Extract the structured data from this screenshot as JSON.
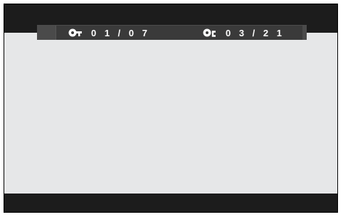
{
  "osd": {
    "title_icon": "title-key-icon",
    "title_value": "0 1 / 0 7",
    "chapter_icon": "chapter-key-icon",
    "chapter_value": "0 3 / 2 1"
  },
  "colors": {
    "frame": "#1c1c1c",
    "content": "#e6e7e8",
    "osd_bar": "#3a3a3a",
    "text": "#ffffff"
  }
}
